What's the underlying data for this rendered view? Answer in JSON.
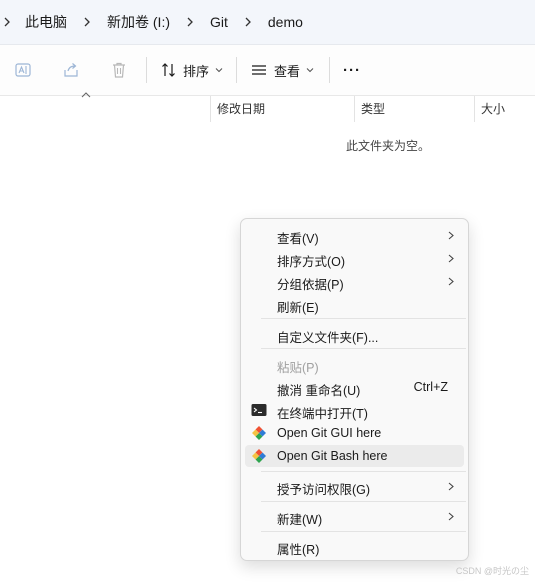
{
  "breadcrumb": {
    "items": [
      "此电脑",
      "新加卷 (I:)",
      "Git",
      "demo"
    ]
  },
  "toolbar": {
    "icons": [
      "rename-icon",
      "share-icon",
      "delete-icon"
    ],
    "sort_label": "排序",
    "view_label": "查看",
    "more_label": "···"
  },
  "columns": {
    "date_modified": "修改日期",
    "type": "类型",
    "size": "大小"
  },
  "empty_message": "此文件夹为空。",
  "context_menu": {
    "view": "查看(V)",
    "sort_by": "排序方式(O)",
    "group_by": "分组依据(P)",
    "refresh": "刷新(E)",
    "customize_folder": "自定义文件夹(F)...",
    "paste": "粘贴(P)",
    "undo_rename": "撤消 重命名(U)",
    "undo_shortcut": "Ctrl+Z",
    "open_terminal": "在终端中打开(T)",
    "open_git_gui": "Open Git GUI here",
    "open_git_bash": "Open Git Bash here",
    "grant_access": "授予访问权限(G)",
    "new": "新建(W)",
    "properties": "属性(R)"
  },
  "watermark": "CSDN @时光の尘",
  "colors": {
    "accent": "#0067c0",
    "git_orange": "#f05133",
    "git_green": "#2ea44f",
    "git_blue": "#2f7bd6"
  }
}
